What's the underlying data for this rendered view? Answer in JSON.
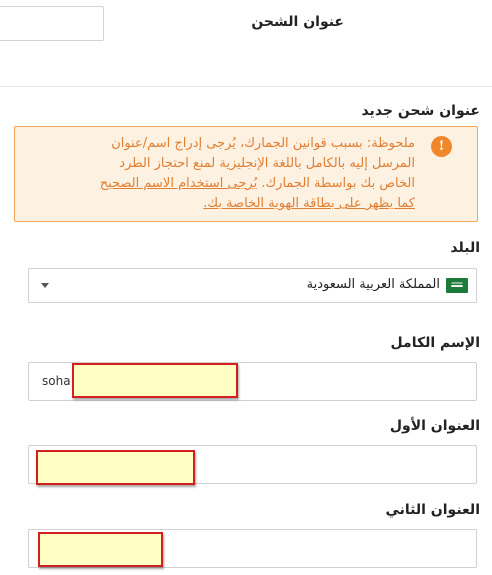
{
  "shipping": {
    "title": "عنوان الشحن",
    "new_address_title": "عنوان شحن جديد"
  },
  "notice": {
    "icon": "info-icon",
    "icon_glyph": "!",
    "text": "ملحوظة: بسبب قوانين الجمارك، يُرجى إدراج اسم/عنوان المرسل إليه بالكامل باللغة الإنجليزية لمنع احتجاز الطرد الخاص بك بواسطة الجمارك. ",
    "link_text": "يُرجى استخدام الاسم الصحيح كما يظهر على بطاقة الهوية الخاصة بك."
  },
  "form": {
    "country": {
      "label": "البلد",
      "value": "المملكة العربية السعودية",
      "flag_icon": "saudi-flag-icon"
    },
    "full_name": {
      "label": "الإسم الكامل",
      "value": "soha"
    },
    "address_1": {
      "label": "العنوان الأول",
      "value": ""
    },
    "address_2": {
      "label": "العنوان الثاني",
      "value": ""
    }
  },
  "colors": {
    "notice_bg": "#fdf1e1",
    "notice_border": "#f3a55a",
    "notice_text": "#e07e32",
    "highlight_fill": "#ffffc4",
    "highlight_border": "#d21f1f"
  }
}
